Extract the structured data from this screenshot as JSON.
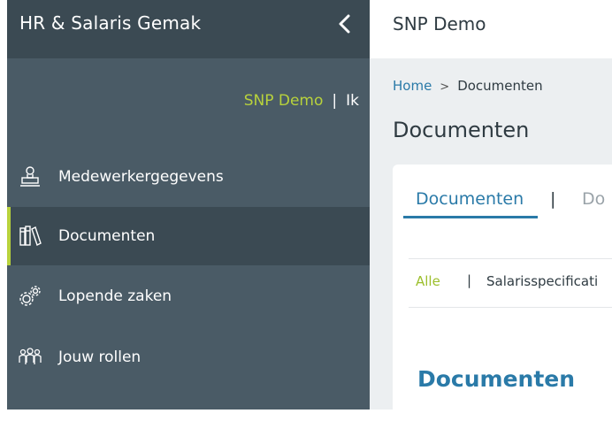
{
  "sidebar": {
    "brand": "HR & Salaris Gemak",
    "collapse_icon": "chevron-left-icon",
    "user": {
      "name": "SNP Demo",
      "separator": "|",
      "me": "Ik"
    },
    "items": [
      {
        "label": "Medewerkergegevens",
        "icon": "stamp-icon",
        "active": false
      },
      {
        "label": "Documenten",
        "icon": "books-icon",
        "active": true
      },
      {
        "label": "Lopende zaken",
        "icon": "gears-icon",
        "active": false
      },
      {
        "label": "Jouw rollen",
        "icon": "people-icon",
        "active": false
      }
    ]
  },
  "topbar": {
    "title": "SNP Demo"
  },
  "breadcrumb": {
    "home": "Home",
    "separator": ">",
    "current": "Documenten"
  },
  "page": {
    "title": "Documenten"
  },
  "tabs": {
    "active": "Documenten",
    "divider": "|",
    "second": "Do"
  },
  "filters": {
    "all": "Alle",
    "separator": "|",
    "salary": "Salarisspecificati"
  },
  "section": {
    "title": "Documenten"
  },
  "colors": {
    "accent": "#b8d23c",
    "link": "#2a7aa8",
    "sidebar": "#4a5b66",
    "sidebar_dark": "#3b4a53"
  }
}
